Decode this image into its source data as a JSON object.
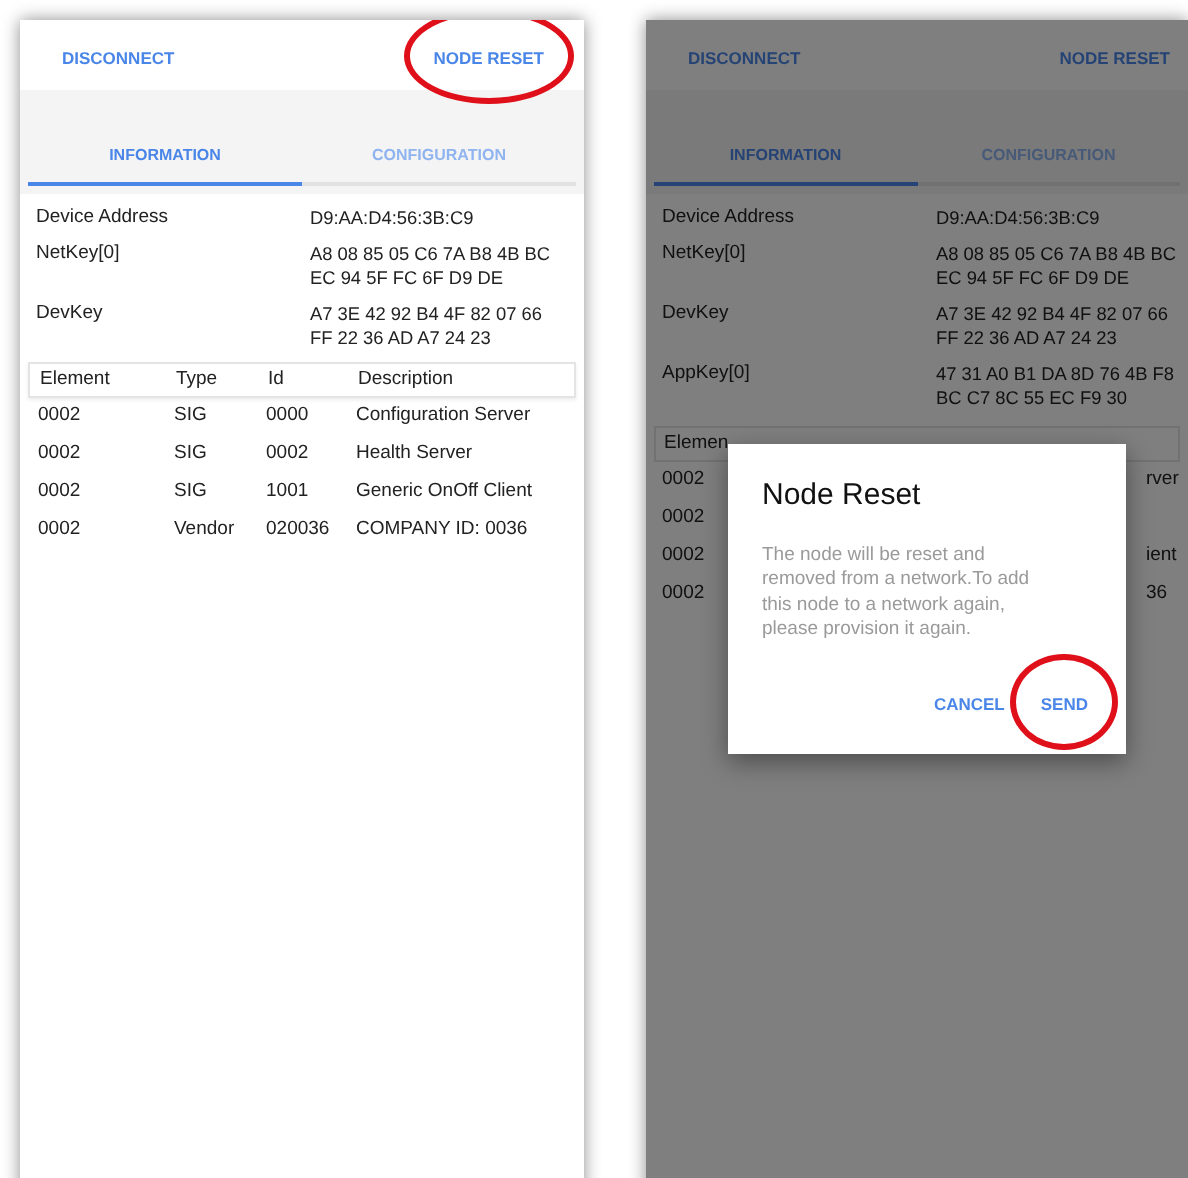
{
  "screens": [
    {
      "dimmed": false,
      "top_bar": [
        {
          "label": "DISCONNECT",
          "highlighted": false
        },
        {
          "label": "NODE RESET",
          "highlighted": true
        }
      ],
      "tabs": [
        {
          "label": "INFORMATION",
          "selected": true
        },
        {
          "label": "CONFIGURATION",
          "selected": false
        }
      ],
      "info": [
        {
          "label": "Device Address",
          "value": "D9:AA:D4:56:3B:C9"
        },
        {
          "label": "NetKey[0]",
          "value": "A8 08 85 05 C6 7A B8 4B BC EC 94 5F FC 6F D9 DE"
        },
        {
          "label": "DevKey",
          "value": "A7 3E 42 92 B4 4F 82 07 66 FF 22 36 AD A7 24 23"
        }
      ],
      "table": {
        "columns": [
          "Element",
          "Type",
          "Id",
          "Description"
        ],
        "rows": [
          [
            "0002",
            "SIG",
            "0000",
            "Configuration Server"
          ],
          [
            "0002",
            "SIG",
            "0002",
            "Health Server"
          ],
          [
            "0002",
            "SIG",
            "1001",
            "Generic OnOff Client"
          ],
          [
            "0002",
            "Vendor",
            "020036",
            "COMPANY ID: 0036"
          ]
        ]
      }
    },
    {
      "dimmed": true,
      "top_bar": [
        {
          "label": "DISCONNECT",
          "highlighted": false
        },
        {
          "label": "NODE RESET",
          "highlighted": false
        }
      ],
      "tabs": [
        {
          "label": "INFORMATION",
          "selected": true
        },
        {
          "label": "CONFIGURATION",
          "selected": false
        }
      ],
      "info": [
        {
          "label": "Device Address",
          "value": "D9:AA:D4:56:3B:C9"
        },
        {
          "label": "NetKey[0]",
          "value": "A8 08 85 05 C6 7A B8 4B BC EC 94 5F FC 6F D9 DE"
        },
        {
          "label": "DevKey",
          "value": "A7 3E 42 92 B4 4F 82 07 66 FF 22 36 AD A7 24 23"
        },
        {
          "label": "AppKey[0]",
          "value": "47 31 A0 B1 DA 8D 76 4B F8 BC C7 8C 55 EC F9 30"
        }
      ],
      "covered_table": {
        "columns": [
          "Elemen"
        ],
        "rows": [
          {
            "element": "0002",
            "description_tail": "rver"
          },
          {
            "element": "0002"
          },
          {
            "element": "0002",
            "description_tail": "ient"
          },
          {
            "element": "0002",
            "description_tail": "36"
          }
        ]
      },
      "dialog": {
        "title": "Node Reset",
        "message": "The node will be reset and removed from a network.To add this node to a network again, please provision it again.",
        "buttons": [
          {
            "label": "CANCEL",
            "highlighted": false
          },
          {
            "label": "SEND",
            "highlighted": true
          }
        ]
      }
    }
  ]
}
